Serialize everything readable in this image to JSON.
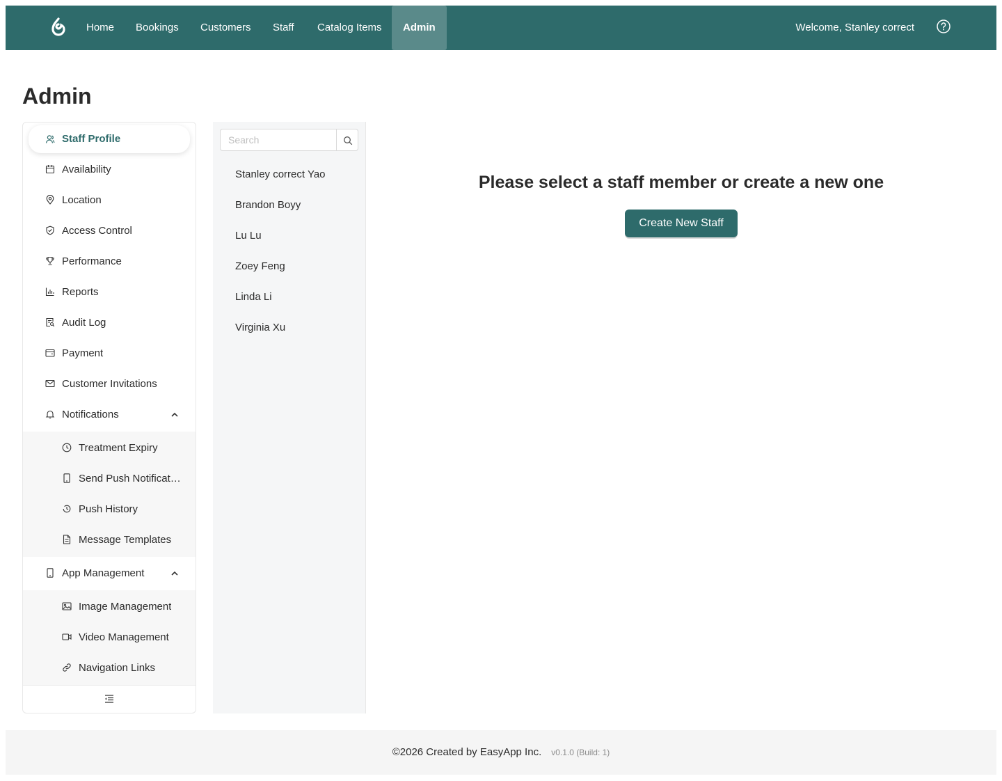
{
  "header": {
    "nav": [
      "Home",
      "Bookings",
      "Customers",
      "Staff",
      "Catalog Items",
      "Admin"
    ],
    "active_nav": "Admin",
    "welcome": "Welcome, Stanley correct",
    "brand_color": "#2e6b6b"
  },
  "page": {
    "title": "Admin"
  },
  "sidebar": {
    "items": [
      {
        "label": "Staff Profile",
        "icon": "user-group-icon"
      },
      {
        "label": "Availability",
        "icon": "calendar-icon"
      },
      {
        "label": "Location",
        "icon": "location-pin-icon"
      },
      {
        "label": "Access Control",
        "icon": "shield-check-icon"
      },
      {
        "label": "Performance",
        "icon": "trophy-icon"
      },
      {
        "label": "Reports",
        "icon": "bar-chart-icon"
      },
      {
        "label": "Audit Log",
        "icon": "file-search-icon"
      },
      {
        "label": "Payment",
        "icon": "wallet-icon"
      },
      {
        "label": "Customer Invitations",
        "icon": "mail-icon"
      },
      {
        "label": "Notifications",
        "icon": "bell-icon"
      },
      {
        "label": "App Management",
        "icon": "mobile-icon"
      }
    ],
    "notifications_sub": [
      {
        "label": "Treatment Expiry",
        "icon": "clock-icon"
      },
      {
        "label": "Send Push Notifications",
        "icon": "mobile-icon"
      },
      {
        "label": "Push History",
        "icon": "history-icon"
      },
      {
        "label": "Message Templates",
        "icon": "document-icon"
      }
    ],
    "app_management_sub": [
      {
        "label": "Image Management",
        "icon": "image-icon"
      },
      {
        "label": "Video Management",
        "icon": "video-icon"
      },
      {
        "label": "Navigation Links",
        "icon": "link-icon"
      }
    ]
  },
  "staff_list": {
    "search_placeholder": "Search",
    "members": [
      "Stanley correct Yao",
      "Brandon Boyy",
      "Lu Lu",
      "Zoey Feng",
      "Linda Li",
      "Virginia Xu"
    ]
  },
  "main": {
    "empty_message": "Please select a staff member or create a new one",
    "create_button": "Create New Staff"
  },
  "footer": {
    "copyright": "©2026 Created by EasyApp Inc.",
    "version": "v0.1.0 (Build: 1)"
  }
}
